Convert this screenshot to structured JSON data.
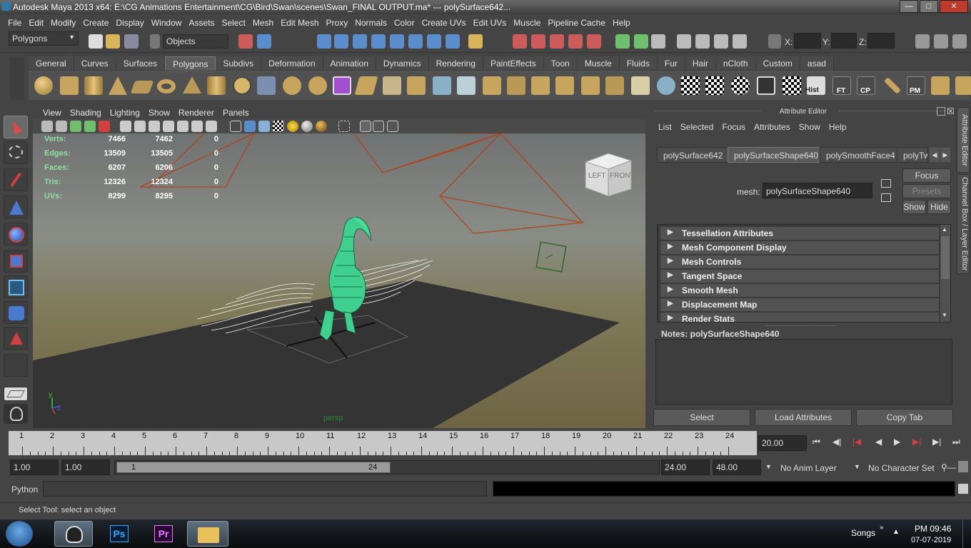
{
  "window": {
    "title": "Autodesk Maya 2013 x64: E:\\CG Animations Entertainment\\CG\\Bird\\Swan\\scenes\\Swan_FINAL OUTPUT.ma*   ---   polySurface642..."
  },
  "menu": [
    "File",
    "Edit",
    "Modify",
    "Create",
    "Display",
    "Window",
    "Assets",
    "Select",
    "Mesh",
    "Edit Mesh",
    "Proxy",
    "Normals",
    "Color",
    "Create UVs",
    "Edit UVs",
    "Muscle",
    "Pipeline Cache",
    "Help"
  ],
  "status": {
    "mode": "Polygons",
    "selection_mask": "Objects",
    "x_label": "X:",
    "y_label": "Y:",
    "z_label": "Z:"
  },
  "shelf_tabs": [
    "General",
    "Curves",
    "Surfaces",
    "Polygons",
    "Subdivs",
    "Deformation",
    "Animation",
    "Dynamics",
    "Rendering",
    "PaintEffects",
    "Toon",
    "Muscle",
    "Fluids",
    "Fur",
    "Hair",
    "nCloth",
    "Custom",
    "asad"
  ],
  "shelf_active": "Polygons",
  "shelf_labels": {
    "hist": "Hist",
    "ft": "FT",
    "cp": "CP",
    "pm": "PM"
  },
  "viewport": {
    "menu": [
      "View",
      "Shading",
      "Lighting",
      "Show",
      "Renderer",
      "Panels"
    ],
    "camera": "persp",
    "viewcube": {
      "left": "LEFT",
      "front": "FRONT"
    },
    "axis": {
      "y": "y",
      "z": "z"
    },
    "hud": [
      {
        "label": "Verts:",
        "a": "7466",
        "b": "7462",
        "c": "0"
      },
      {
        "label": "Edges:",
        "a": "13509",
        "b": "13505",
        "c": "0"
      },
      {
        "label": "Faces:",
        "a": "6207",
        "b": "6206",
        "c": "0"
      },
      {
        "label": "Tris:",
        "a": "12326",
        "b": "12324",
        "c": "0"
      },
      {
        "label": "UVs:",
        "a": "8299",
        "b": "8295",
        "c": "0"
      }
    ]
  },
  "attr": {
    "title": "Attribute Editor",
    "menu": [
      "List",
      "Selected",
      "Focus",
      "Attributes",
      "Show",
      "Help"
    ],
    "tabs": [
      "polySurface642",
      "polySurfaceShape640",
      "polySmoothFace4",
      "polyTwe"
    ],
    "active_tab": "polySurfaceShape640",
    "mesh_label": "mesh:",
    "mesh_value": "polySurfaceShape640",
    "focus": "Focus",
    "presets": "Presets",
    "show": "Show",
    "hide": "Hide",
    "sections": [
      "Tessellation Attributes",
      "Mesh Component Display",
      "Mesh Controls",
      "Tangent Space",
      "Smooth Mesh",
      "Displacement Map",
      "Render Stats"
    ],
    "notes": "Notes:  polySurfaceShape640",
    "buttons": {
      "select": "Select",
      "load": "Load Attributes",
      "copy": "Copy Tab"
    },
    "side_tabs": {
      "attribute_editor": "Attribute Editor",
      "channel_box": "Channel Box / Layer Editor"
    }
  },
  "timeline": {
    "ticks": [
      "1",
      "2",
      "3",
      "4",
      "5",
      "6",
      "7",
      "8",
      "9",
      "10",
      "11",
      "12",
      "13",
      "14",
      "15",
      "16",
      "17",
      "18",
      "19",
      "20",
      "21",
      "22",
      "23",
      "24"
    ],
    "current": "20.00"
  },
  "range": {
    "start": "1.00",
    "anim_start": "1.00",
    "slider_start": "1",
    "slider_end": "24",
    "anim_end": "24.00",
    "end": "48.00",
    "anim_layer": "No Anim Layer",
    "char_set": "No Character Set"
  },
  "cmd": {
    "lang": "Python"
  },
  "help": "Select Tool: select an object",
  "taskbar": {
    "songs": "Songs",
    "time": "PM 09:46",
    "date": "07-07-2019",
    "ps": "Ps",
    "pr": "Pr"
  }
}
